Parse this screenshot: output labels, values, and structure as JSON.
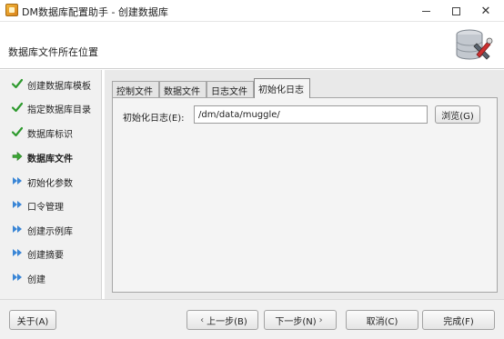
{
  "window": {
    "title": "DM数据库配置助手 - 创建数据库"
  },
  "header": {
    "title": "数据库文件所在位置",
    "logo_icon": "database-tools-icon"
  },
  "sidebar": {
    "items": [
      {
        "label": "创建数据库模板",
        "state": "done",
        "icon": "check-icon"
      },
      {
        "label": "指定数据库目录",
        "state": "done",
        "icon": "check-icon"
      },
      {
        "label": "数据库标识",
        "state": "done",
        "icon": "check-icon"
      },
      {
        "label": "数据库文件",
        "state": "current",
        "icon": "arrow-right-icon"
      },
      {
        "label": "初始化参数",
        "state": "pending",
        "icon": "double-arrow-icon"
      },
      {
        "label": "口令管理",
        "state": "pending",
        "icon": "double-arrow-icon"
      },
      {
        "label": "创建示例库",
        "state": "pending",
        "icon": "double-arrow-icon"
      },
      {
        "label": "创建摘要",
        "state": "pending",
        "icon": "double-arrow-icon"
      },
      {
        "label": "创建",
        "state": "pending",
        "icon": "double-arrow-icon"
      }
    ]
  },
  "tabs": [
    {
      "label": "控制文件",
      "active": false
    },
    {
      "label": "数据文件",
      "active": false
    },
    {
      "label": "日志文件",
      "active": false
    },
    {
      "label": "初始化日志",
      "active": true
    }
  ],
  "form": {
    "init_log_label": "初始化日志(E):",
    "init_log_value": "/dm/data/muggle/",
    "browse_label": "浏览(G)"
  },
  "footer": {
    "about_label": "关于(A)",
    "prev_label": "上一步(B)",
    "next_label": "下一步(N)",
    "cancel_label": "取消(C)",
    "finish_label": "完成(F)"
  },
  "colors": {
    "check": "#2e9a2e",
    "current_arrow": "#3aa534",
    "pending_arrow": "#3a86d6"
  }
}
